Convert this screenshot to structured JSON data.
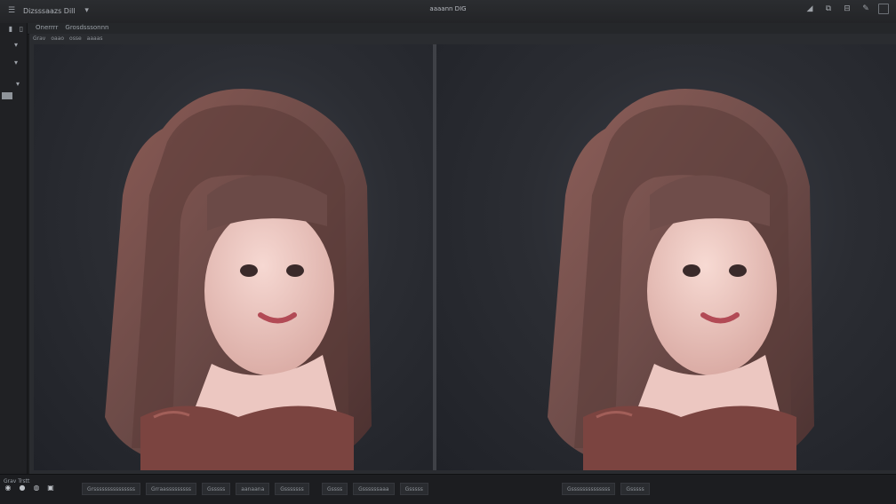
{
  "titlebar": {
    "app_name": "Dizsssaazs Dill",
    "title": "aaaann DIG"
  },
  "toolbar": {
    "tabs": [
      "Onerrrr",
      "Grosdsssonnn"
    ]
  },
  "workspace": {
    "labels": [
      "Grav",
      "oaao",
      "osse",
      "aaaas"
    ]
  },
  "statusbar": {
    "zoom_text": "Grav Trstt",
    "items": [
      "Grsssssssssssssss",
      "Grraasssssssss",
      "Gsssss",
      "aanaana",
      "Gsssssss",
      "Gssss",
      "Gssssssaaa",
      "Gsssss",
      "Gssssssssssssss",
      "Gsssss"
    ]
  },
  "colors": {
    "background": "#1b1c1e",
    "panel": "#2a2c30",
    "hair": "#6b4a47",
    "skin": "#ecc7c1",
    "top": "#7b4440"
  }
}
